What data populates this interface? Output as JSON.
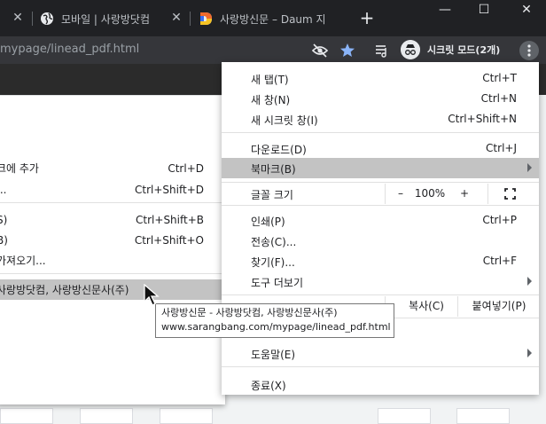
{
  "tabs": [
    {
      "title": ""
    },
    {
      "title": "모바일 | 사랑방닷컴"
    },
    {
      "title": "사랑방신문 – Daum 지"
    }
  ],
  "toolbar": {
    "url": "mypage/linead_pdf.html",
    "profile_label": "시크릿 모드(2개)"
  },
  "colors": {
    "chrome_dark": "#202124",
    "toolbar": "#35363a",
    "menu_highlight": "#c3c3c3",
    "star_blue": "#8ab4f8"
  },
  "icons": {
    "tab_1": "close-icon",
    "tab_2": "globe-icon",
    "tab_3": "daum-logo-icon",
    "toolbar": [
      "eye-off-icon",
      "star-icon",
      "reading-list-icon",
      "incognito-icon",
      "kebab-menu-icon"
    ],
    "fullscreen": "fullscreen-icon"
  },
  "bookmarks_menu": {
    "rows": [
      {
        "label": "크에 추가",
        "shortcut": "Ctrl+D"
      },
      {
        "label": "...",
        "shortcut": "Ctrl+Shift+D"
      },
      {
        "label": "S)",
        "shortcut": "Ctrl+Shift+B"
      },
      {
        "label": "B)",
        "shortcut": "Ctrl+Shift+O"
      },
      {
        "label": " 가져오기...",
        "shortcut": ""
      },
      {
        "label": "사랑방닷컴, 사랑방신문사(주)",
        "shortcut": ""
      }
    ]
  },
  "main_menu": {
    "new_tab": {
      "label": "새 탭(T)",
      "shortcut": "Ctrl+T"
    },
    "new_window": {
      "label": "새 창(N)",
      "shortcut": "Ctrl+N"
    },
    "new_incognito": {
      "label": "새 시크릿 창(I)",
      "shortcut": "Ctrl+Shift+N"
    },
    "downloads": {
      "label": "다운로드(D)",
      "shortcut": "Ctrl+J"
    },
    "bookmarks": {
      "label": "북마크(B)"
    },
    "zoom": {
      "label": "글꼴 크기",
      "minus": "–",
      "value": "100%",
      "plus": "+"
    },
    "print": {
      "label": "인쇄(P)",
      "shortcut": "Ctrl+P"
    },
    "cast": {
      "label": "전송(C)..."
    },
    "find": {
      "label": "찾기(F)...",
      "shortcut": "Ctrl+F"
    },
    "more_tools": {
      "label": "도구 더보기"
    },
    "edit": {
      "copy": "복사(C)",
      "paste": "붙여넣기(P)"
    },
    "help": {
      "label": "도움말(E)"
    },
    "exit": {
      "label": "종료(X)"
    }
  },
  "tooltip": {
    "title": "사랑방신문 - 사랑방닷컴, 사랑방신문사(주)",
    "url": "www.sarangbang.com/mypage/linead_pdf.html"
  }
}
